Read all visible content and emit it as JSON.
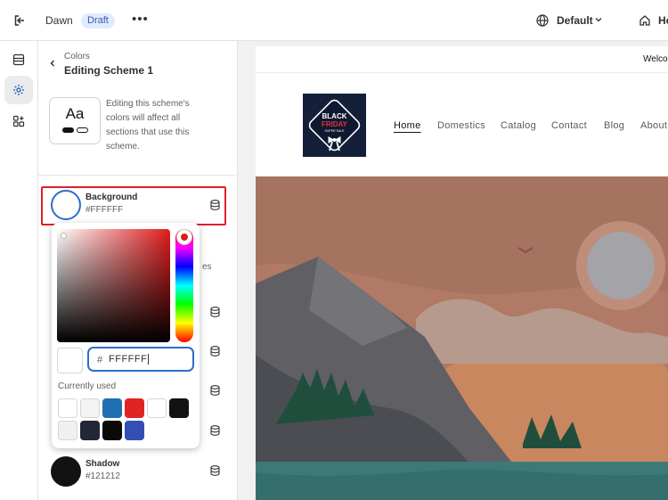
{
  "topbar": {
    "theme_name": "Dawn",
    "badge": "Draft",
    "more": "•••",
    "locale": "Default",
    "home_label": "Ho"
  },
  "panel": {
    "breadcrumb": "Colors",
    "title": "Editing Scheme 1",
    "typography_sample": "Aa",
    "description": "Editing this scheme's colors will affect all sections that use this scheme.",
    "partial_text": "es"
  },
  "color_rows": [
    {
      "name": "Background",
      "value": "#FFFFFF"
    },
    {
      "name": "Shadow",
      "value": "#121212"
    }
  ],
  "picker": {
    "hash": "#",
    "hex_value": "FFFFFF",
    "currently_used_label": "Currently used",
    "hue": "#e01c1c",
    "swatches": [
      "#ffffff",
      "#f3f3f3",
      "#1f6fb2",
      "#e02424",
      "#ffffff",
      "#121212",
      "#f0f0f0",
      "#232637",
      "#0a0a0a",
      "#334fb4"
    ]
  },
  "preview": {
    "announcement": "Welco",
    "logo": {
      "line1": "BLACK",
      "line2": "FRIDAY",
      "line3": "SUPER SALE"
    },
    "nav": [
      "Home",
      "Domestics",
      "Catalog",
      "Contact",
      "Blog",
      "About"
    ]
  },
  "colors": {
    "accent_blue": "#2c6ecb",
    "selection_red": "#e01e2d",
    "hero_sky": "#b07a66",
    "hero_sea": "#3b7a78"
  }
}
